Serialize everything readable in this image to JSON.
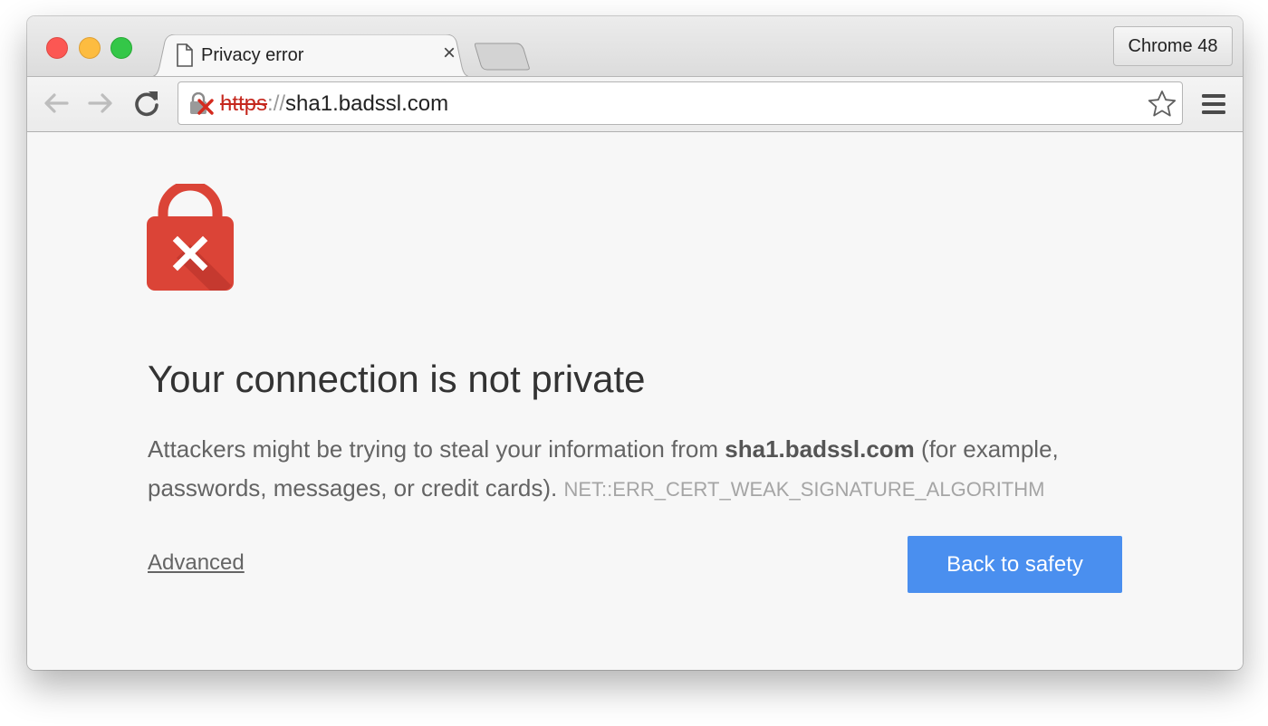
{
  "browser": {
    "tab": {
      "title": "Privacy error",
      "close_glyph": "×",
      "icon": "document-icon"
    },
    "new_tab_icon": "new-tab-icon",
    "profile_label": "Chrome 48",
    "address_bar": {
      "scheme": "https",
      "separator": "://",
      "host": "sha1.badssl.com",
      "security_icon": "lock-broken-icon"
    },
    "icons": {
      "back": "back-arrow-icon",
      "forward": "forward-arrow-icon",
      "reload": "reload-icon",
      "bookmark": "star-icon",
      "menu": "hamburger-menu-icon"
    }
  },
  "interstitial": {
    "icon": "lock-error-icon",
    "heading": "Your connection is not private",
    "message": {
      "before": "Attackers might be trying to steal your information from ",
      "host": "sha1.badssl.com",
      "after": " (for example, passwords, messages, or credit cards). ",
      "error_code": "NET::ERR_CERT_WEAK_SIGNATURE_ALGORITHM"
    },
    "advanced_label": "Advanced",
    "back_label": "Back to safety"
  },
  "colors": {
    "primary_button": "#4a8fef",
    "lock_red": "#db4437",
    "url_scheme_red": "#c5271d"
  }
}
